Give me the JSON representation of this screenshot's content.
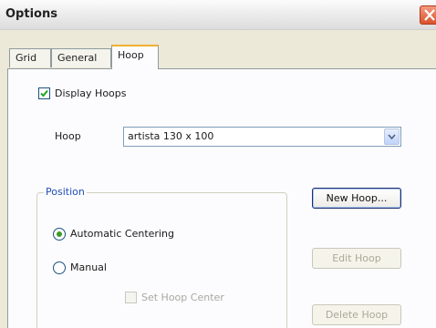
{
  "window": {
    "title": "Options"
  },
  "tabs": [
    {
      "label": "Grid"
    },
    {
      "label": "General"
    },
    {
      "label": "Hoop"
    }
  ],
  "hoop_tab": {
    "display_hoops": {
      "label": "Display Hoops",
      "checked": true
    },
    "hoop_select": {
      "label": "Hoop",
      "value": "artista 130 x 100"
    },
    "position_group": {
      "title": "Position",
      "automatic_centering": {
        "label": "Automatic Centering",
        "selected": true
      },
      "manual": {
        "label": "Manual",
        "selected": false
      },
      "set_hoop_center": {
        "label": "Set Hoop Center",
        "checked": false,
        "enabled": false
      }
    },
    "buttons": {
      "new_hoop": "New Hoop...",
      "edit_hoop": "Edit Hoop",
      "delete_hoop": "Delete Hoop"
    }
  },
  "colors": {
    "active_tab_accent": "#f0b030",
    "group_title": "#1f4fb5",
    "radio_dot": "#3b9b28",
    "close_button": "#d9532c"
  }
}
